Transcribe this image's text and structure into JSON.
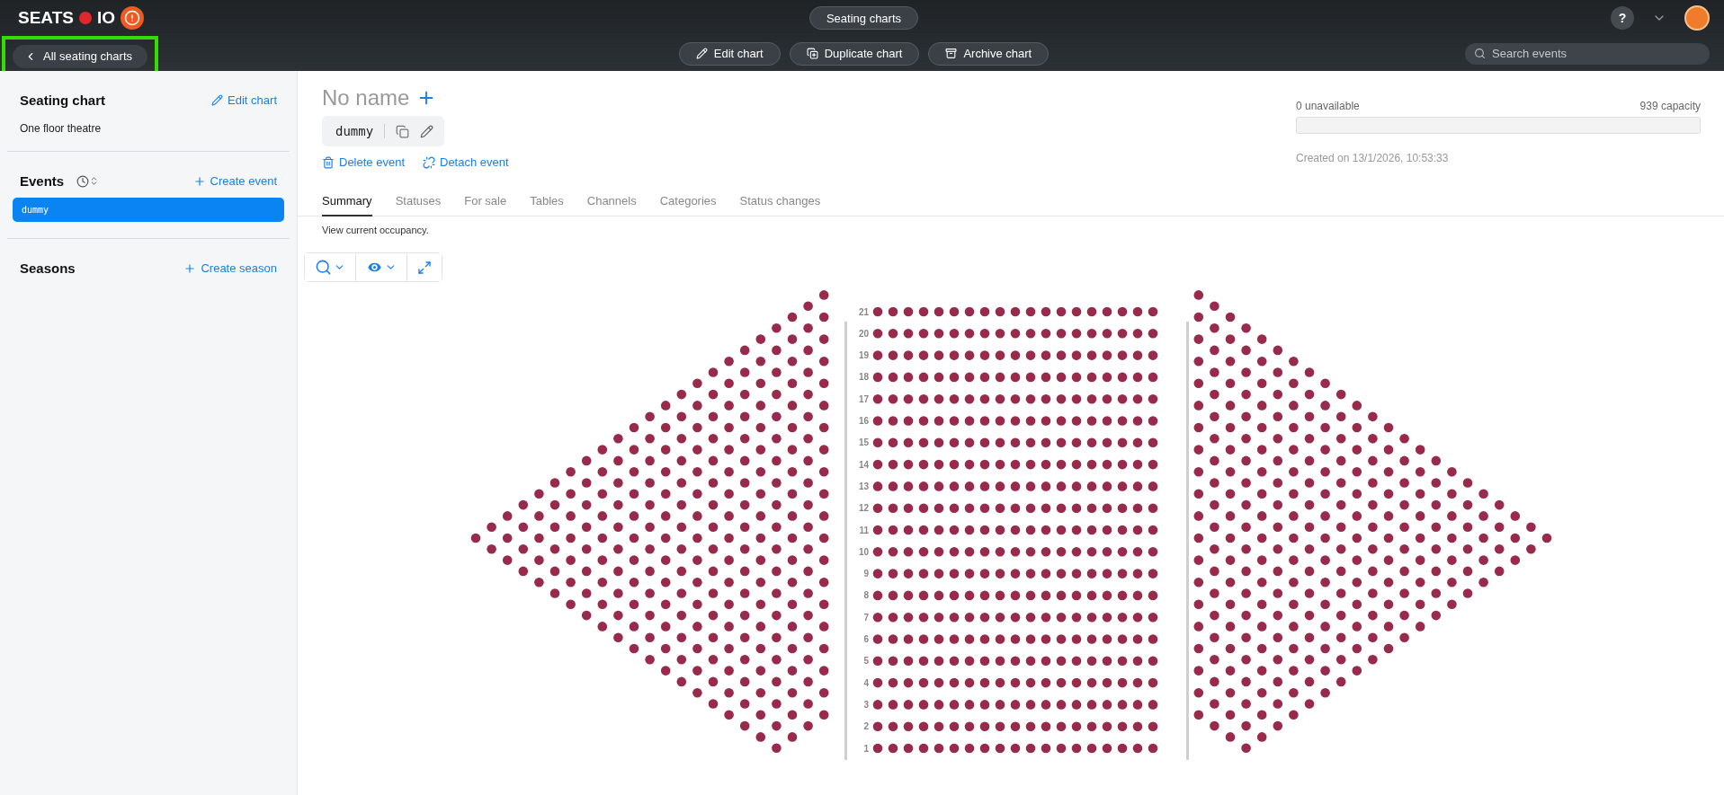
{
  "topbar": {
    "logo": {
      "left": "SEATS",
      "right": "IO"
    },
    "section_button": "Seating charts",
    "back_button": {
      "label": "All seating charts",
      "highlighted": true
    },
    "actions": [
      {
        "kind": "edit",
        "label": "Edit chart"
      },
      {
        "kind": "duplicate",
        "label": "Duplicate chart"
      },
      {
        "kind": "archive",
        "label": "Archive chart"
      }
    ],
    "help_label": "?",
    "search": {
      "placeholder": "Search events"
    }
  },
  "sidebar": {
    "seating_chart": {
      "title": "Seating chart",
      "action": "Edit chart",
      "name": "One floor theatre"
    },
    "events": {
      "title": "Events",
      "action": "Create event",
      "items": [
        {
          "label": "dummy",
          "selected": true
        }
      ]
    },
    "seasons": {
      "title": "Seasons",
      "action": "Create season"
    }
  },
  "event": {
    "name": "No name",
    "key": "dummy",
    "actions": [
      {
        "kind": "delete",
        "label": "Delete event"
      },
      {
        "kind": "detach",
        "label": "Detach event"
      }
    ]
  },
  "stats": {
    "unavailable": "0 unavailable",
    "capacity": "939 capacity",
    "level": 0,
    "created": "Created on 13/1/2026, 10:53:33"
  },
  "tabs": [
    {
      "label": "Summary",
      "selected": true
    },
    {
      "label": "Statuses",
      "selected": false
    },
    {
      "label": "For sale",
      "selected": false
    },
    {
      "label": "Tables",
      "selected": false
    },
    {
      "label": "Channels",
      "selected": false
    },
    {
      "label": "Categories",
      "selected": false
    },
    {
      "label": "Status changes",
      "selected": false
    }
  ],
  "tab_description": "View current occupancy.",
  "seat_map": {
    "row_labels": [
      "21",
      "20",
      "19",
      "18",
      "17",
      "16",
      "15",
      "14",
      "13",
      "12",
      "11",
      "10",
      "9",
      "8",
      "7",
      "6",
      "5",
      "4",
      "3",
      "2",
      "1"
    ]
  }
}
